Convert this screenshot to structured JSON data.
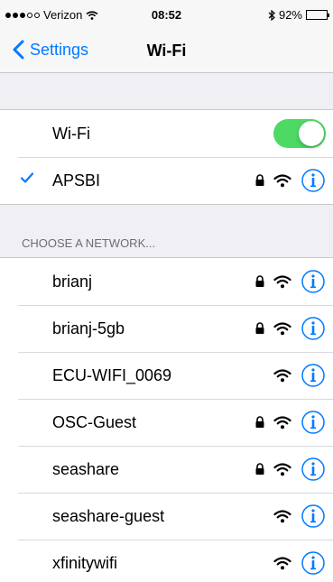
{
  "status_bar": {
    "carrier": "Verizon",
    "time": "08:52",
    "battery_percent_text": "92%",
    "battery_level": 0.92,
    "signal_bars_filled": 3,
    "signal_bars_total": 5
  },
  "nav": {
    "back_label": "Settings",
    "title": "Wi-Fi"
  },
  "wifi": {
    "label": "Wi-Fi",
    "enabled": true,
    "connected": {
      "name": "APSBI",
      "secured": true,
      "checked": true
    }
  },
  "section_header": "CHOOSE A NETWORK...",
  "networks": [
    {
      "name": "brianj",
      "secured": true
    },
    {
      "name": "brianj-5gb",
      "secured": true
    },
    {
      "name": "ECU-WIFI_0069",
      "secured": false
    },
    {
      "name": "OSC-Guest",
      "secured": true
    },
    {
      "name": "seashare",
      "secured": true
    },
    {
      "name": "seashare-guest",
      "secured": false
    },
    {
      "name": "xfinitywifi",
      "secured": false
    }
  ],
  "colors": {
    "accent": "#007aff",
    "toggle_on": "#4cd964",
    "background": "#efeff4"
  },
  "icons": {
    "back": "chevron-left-icon",
    "check": "checkmark-icon",
    "lock": "lock-icon",
    "wifi": "wifi-icon",
    "info": "info-circle-icon",
    "bluetooth": "bluetooth-icon",
    "battery": "battery-icon"
  }
}
